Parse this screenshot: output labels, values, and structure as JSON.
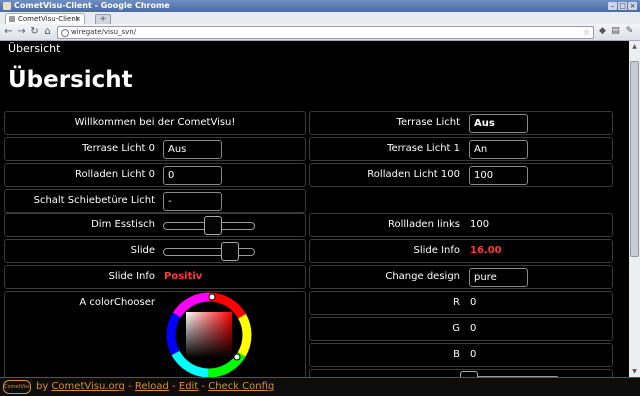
{
  "window": {
    "title": "CometVisu-Client - Google Chrome"
  },
  "browser": {
    "tab_label": "CometVisu-Client",
    "tab_close": "×",
    "new_tab": "+",
    "address": "wiregate/visu_svn/",
    "nav": {
      "back": "←",
      "forward": "→",
      "reload": "↻",
      "home": "⌂"
    }
  },
  "page": {
    "breadcrumb": "Übersicht",
    "heading": "Übersicht",
    "welcome": "Willkommen bei der CometVisu!",
    "left": [
      {
        "label": "Terrase Licht 0",
        "value": "Aus"
      },
      {
        "label": "Rolladen Licht 0",
        "value": "0"
      },
      {
        "label": "Schalt Schiebetüre Licht",
        "value": "-"
      },
      {
        "label": "Dim Esstisch",
        "slider_fraction": 0.55
      },
      {
        "label": "Slide",
        "slider_fraction": 0.78
      },
      {
        "label": "Slide Info",
        "value": "Positiv"
      },
      {
        "label": "A colorChooser"
      }
    ],
    "right": [
      {
        "label": "Terrase Licht",
        "value": "Aus"
      },
      {
        "label": "Terrase Licht 1",
        "value": "An"
      },
      {
        "label": "Rolladen Licht 100",
        "value": "100"
      },
      {
        "label": "Rollladen links",
        "value": "100"
      },
      {
        "label": "Slide Info",
        "value": "16.00"
      },
      {
        "label": "Change design",
        "value": "pure"
      },
      {
        "label": "R",
        "value": "0"
      },
      {
        "label": "G",
        "value": "0"
      },
      {
        "label": "B",
        "value": "0"
      }
    ]
  },
  "footer": {
    "logo": "CometVisu",
    "by": "by",
    "link_site": "CometVisu.org",
    "link_reload": "Reload",
    "link_edit": "Edit",
    "link_check": "Check Config",
    "sep": " - "
  },
  "colors": {
    "accent_red": "#ff3b30",
    "footer_orange": "#d9902a"
  }
}
